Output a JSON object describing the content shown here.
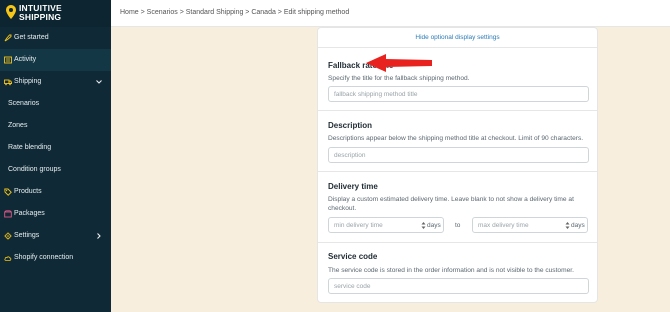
{
  "brand": {
    "line1": "INTUITIVE",
    "line2": "SHIPPING",
    "pin_color": "#f5c518"
  },
  "sidebar": {
    "items": [
      {
        "label": "Get started",
        "icon": "rocket-icon"
      },
      {
        "label": "Activity",
        "icon": "activity-icon"
      },
      {
        "label": "Shipping",
        "icon": "truck-icon",
        "expanded": true
      },
      {
        "label": "Scenarios",
        "sub": true
      },
      {
        "label": "Zones",
        "sub": true
      },
      {
        "label": "Rate blending",
        "sub": true
      },
      {
        "label": "Condition groups",
        "sub": true
      },
      {
        "label": "Products",
        "icon": "tag-icon"
      },
      {
        "label": "Packages",
        "icon": "package-icon"
      },
      {
        "label": "Settings",
        "icon": "gear-icon"
      },
      {
        "label": "Shopify connection",
        "icon": "cloud-icon"
      }
    ]
  },
  "header": {
    "breadcrumb": "Home > Scenarios > Standard Shipping > Canada > Edit shipping method"
  },
  "card": {
    "hide_link": "Hide optional display settings",
    "fallback": {
      "title": "Fallback rate title",
      "desc": "Specify the title for the fallback shipping method.",
      "placeholder": "fallback shipping method title"
    },
    "description": {
      "title": "Description",
      "desc": "Descriptions appear below the shipping method title at checkout. Limit of 90 characters.",
      "placeholder": "description"
    },
    "delivery": {
      "title": "Delivery time",
      "desc": "Display a custom estimated delivery time. Leave blank to not show a delivery time at checkout.",
      "min_placeholder": "min delivery time",
      "max_placeholder": "max delivery time",
      "unit": "days",
      "to_label": "to"
    },
    "service": {
      "title": "Service code",
      "desc": "The service code is stored in the order information and is not visible to the customer.",
      "placeholder": "service code"
    }
  },
  "colors": {
    "sidebar_bg": "#0f2a36",
    "page_bg": "#f7eedd",
    "link": "#2c7bb6",
    "arrow": "#e8231f",
    "icon": "#f5c518"
  }
}
